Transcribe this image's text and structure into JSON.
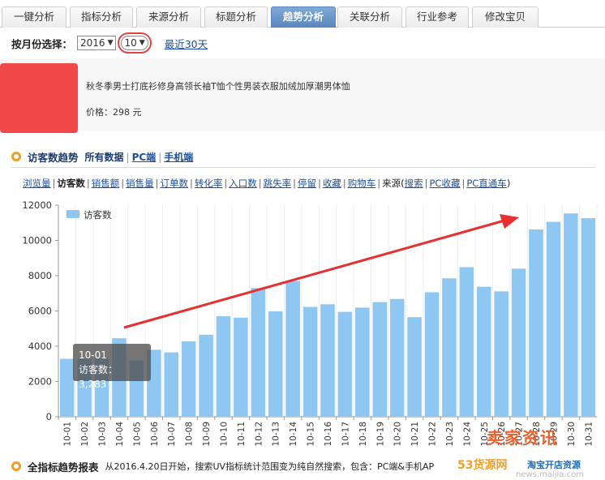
{
  "tabs": [
    {
      "label": "一键分析",
      "active": false
    },
    {
      "label": "指标分析",
      "active": false
    },
    {
      "label": "来源分析",
      "active": false
    },
    {
      "label": "标题分析",
      "active": false
    },
    {
      "label": "趋势分析",
      "active": true
    },
    {
      "label": "关联分析",
      "active": false
    },
    {
      "label": "行业参考",
      "active": false
    },
    {
      "label": "修改宝贝",
      "active": false
    }
  ],
  "filter": {
    "label": "按月份选择：",
    "year": "2016",
    "month": "10",
    "recent": "最近30天"
  },
  "product": {
    "name": "秋冬季男士打底衫修身高领长袖T恤个性男装衣服加绒加厚潮男体恤",
    "price": "价格：298 元"
  },
  "section": {
    "title": "访客数趋势",
    "filters": [
      "所有数据",
      "PC端",
      "手机端"
    ]
  },
  "metrics": {
    "items": [
      "浏览量",
      "访客数",
      "销售额",
      "销售量",
      "订单数",
      "转化率",
      "入口数",
      "跳失率",
      "停留",
      "收藏",
      "购物车"
    ],
    "current": "访客数",
    "source_prefix": "来源(",
    "source_items": [
      "搜索",
      "PC收藏",
      "PC直通车"
    ],
    "source_suffix": ")"
  },
  "tooltip": {
    "date": "10-01",
    "text": "访客数：3,283"
  },
  "footer": {
    "title": "全指标趋势报表",
    "note": "从2016.4.20日开始，搜索UV指标统计范围变为纯自然搜索，包含：PC端&手机AP"
  },
  "watermark": {
    "line1": "53货源网",
    "line2": "卖家资讯",
    "line3": "淘宝开店资源",
    "line4": "news.maijia.com"
  },
  "colors": {
    "bar": "#8ec8f2",
    "arrow": "#e83030",
    "accent": "#f0a026",
    "active_tab": "#6b98cb",
    "link": "#1f4e9a"
  },
  "chart_data": {
    "type": "bar",
    "legend": "访客数",
    "categories": [
      "10-01",
      "10-02",
      "10-03",
      "10-04",
      "10-05",
      "10-06",
      "10-07",
      "10-08",
      "10-09",
      "10-10",
      "10-11",
      "10-12",
      "10-13",
      "10-14",
      "10-15",
      "10-16",
      "10-17",
      "10-18",
      "10-19",
      "10-20",
      "10-21",
      "10-22",
      "10-23",
      "10-24",
      "10-25",
      "10-26",
      "10-27",
      "10-28",
      "10-29",
      "10-30",
      "10-31"
    ],
    "values": [
      3283,
      3300,
      3300,
      4450,
      3200,
      3800,
      3650,
      4280,
      4650,
      5700,
      5620,
      7300,
      5980,
      7700,
      6230,
      6380,
      5950,
      6190,
      6500,
      6680,
      5650,
      7060,
      7850,
      8480,
      7370,
      7110,
      8400,
      10620,
      11050,
      11530,
      11260
    ],
    "ylim": [
      0,
      12000
    ],
    "yticks": [
      "0",
      "2000",
      "4000",
      "6000",
      "8000",
      "10000",
      "12000"
    ],
    "grid": "vertical",
    "legend_position": "top-left"
  }
}
